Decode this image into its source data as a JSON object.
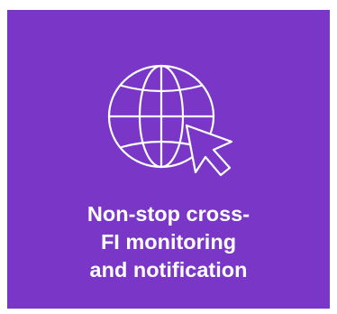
{
  "tile": {
    "icon": "globe-cursor-icon",
    "title_lines": [
      "Non-stop cross-",
      "FI monitoring",
      "and notification"
    ],
    "background_color": "#7a37c7",
    "text_color": "#ffffff"
  }
}
